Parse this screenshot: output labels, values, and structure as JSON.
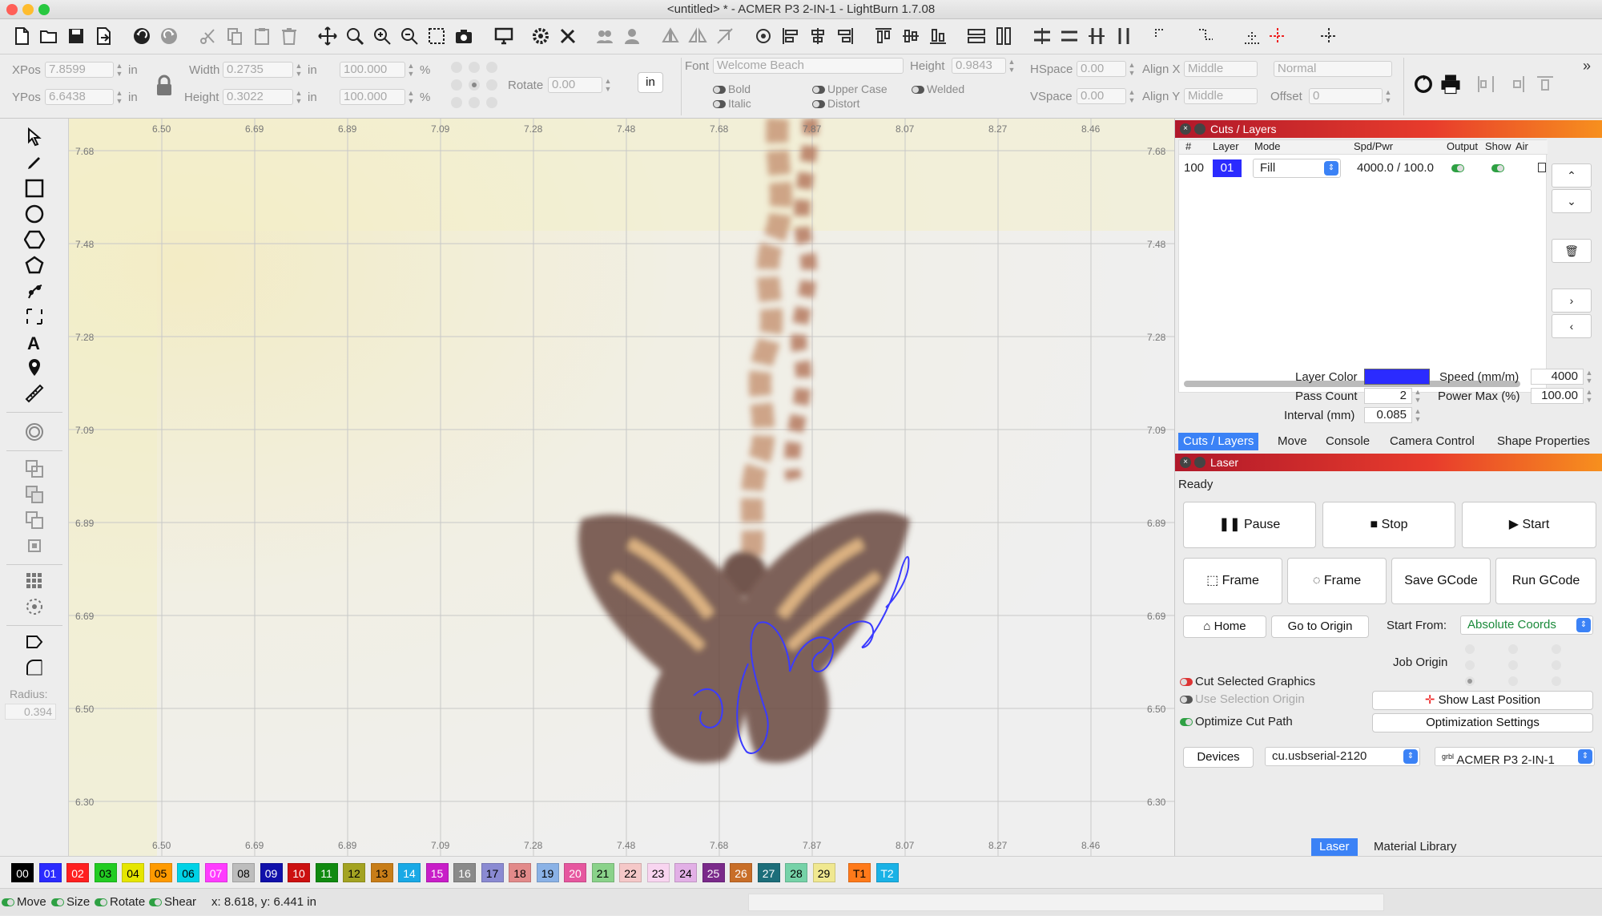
{
  "window": {
    "title": "<untitled> * - ACMER P3 2-IN-1 - LightBurn 1.7.08"
  },
  "props": {
    "xpos_label": "XPos",
    "xpos_value": "7.8599",
    "xpos_unit": "in",
    "ypos_label": "YPos",
    "ypos_value": "6.6438",
    "ypos_unit": "in",
    "width_label": "Width",
    "width_value": "0.2735",
    "width_unit": "in",
    "height_label": "Height",
    "height_value": "0.3022",
    "height_unit": "in",
    "scale_w": "100.000",
    "scale_h": "100.000",
    "pct": "%",
    "rotate_label": "Rotate",
    "rotate_value": "0.00",
    "units_button": "in",
    "font_label": "Font",
    "font_value": "Welcome Beach",
    "fheight_label": "Height",
    "fheight_value": "0.9843",
    "hspace_label": "HSpace",
    "hspace_value": "0.00",
    "vspace_label": "VSpace",
    "vspace_value": "0.00",
    "alignx_label": "Align X",
    "alignx_value": "Middle",
    "aligny_label": "Align Y",
    "aligny_value": "Middle",
    "normal_value": "Normal",
    "offset_label": "Offset",
    "offset_value": "0",
    "bold": "Bold",
    "italic": "Italic",
    "upper_case": "Upper Case",
    "distort": "Distort",
    "welded": "Welded"
  },
  "ruler": {
    "x": [
      "6.50",
      "6.69",
      "6.89",
      "7.09",
      "7.28",
      "7.48",
      "7.68",
      "7.87",
      "8.07",
      "8.27",
      "8.46"
    ],
    "y": [
      "7.68",
      "7.48",
      "7.28",
      "7.09",
      "6.89",
      "6.69",
      "6.50",
      "6.30"
    ]
  },
  "canvas": {
    "text": "Mom"
  },
  "left": {
    "radius_label": "Radius:",
    "radius_value": "0.394"
  },
  "cuts": {
    "title": "Cuts / Layers",
    "headers": [
      "#",
      "Layer",
      "Mode",
      "Spd/Pwr",
      "Output",
      "Show",
      "Air"
    ],
    "row": {
      "num": "100",
      "layer": "01",
      "mode": "Fill",
      "spd": "4000.0 / 100.0"
    },
    "layer_color_label": "Layer Color",
    "layer_color": "#2b2bff",
    "speed_label": "Speed (mm/m)",
    "speed_value": "4000",
    "pass_label": "Pass Count",
    "pass_value": "2",
    "power_label": "Power Max (%)",
    "power_value": "100.00",
    "interval_label": "Interval (mm)",
    "interval_value": "0.085"
  },
  "tabs": [
    "Cuts / Layers",
    "Move",
    "Console",
    "Camera Control",
    "Shape Properties"
  ],
  "laser": {
    "title": "Laser",
    "status": "Ready",
    "pause": "Pause",
    "stop": "Stop",
    "start": "Start",
    "frame1": "Frame",
    "frame2": "Frame",
    "save_gcode": "Save GCode",
    "run_gcode": "Run GCode",
    "home": "Home",
    "go_origin": "Go to Origin",
    "start_from_label": "Start From:",
    "start_from_value": "Absolute Coords",
    "job_origin": "Job Origin",
    "cut_selected": "Cut Selected Graphics",
    "use_selection": "Use Selection Origin",
    "optimize_path": "Optimize Cut Path",
    "show_last": "Show Last Position",
    "opt_settings": "Optimization Settings",
    "devices": "Devices",
    "port": "cu.usbserial-2120",
    "device_prefix": "grbl",
    "device": "ACMER P3 2-IN-1"
  },
  "bottom_tabs": [
    "Laser",
    "Material Library"
  ],
  "palette": [
    {
      "l": "00",
      "c": "#000000",
      "t": "#ffffff"
    },
    {
      "l": "01",
      "c": "#2b2bff",
      "t": "#ffffff"
    },
    {
      "l": "02",
      "c": "#ff2020",
      "t": "#ffffff"
    },
    {
      "l": "03",
      "c": "#22cc22",
      "t": "#000000"
    },
    {
      "l": "04",
      "c": "#e6e600",
      "t": "#000000"
    },
    {
      "l": "05",
      "c": "#ff9a00",
      "t": "#000000"
    },
    {
      "l": "06",
      "c": "#00d2e6",
      "t": "#000000"
    },
    {
      "l": "07",
      "c": "#ff3cff",
      "t": "#ffffff"
    },
    {
      "l": "08",
      "c": "#bdbdbd",
      "t": "#000000"
    },
    {
      "l": "09",
      "c": "#1010aa",
      "t": "#ffffff"
    },
    {
      "l": "10",
      "c": "#cc1010",
      "t": "#ffffff"
    },
    {
      "l": "11",
      "c": "#108a10",
      "t": "#ffffff"
    },
    {
      "l": "12",
      "c": "#a3a322",
      "t": "#000000"
    },
    {
      "l": "13",
      "c": "#c87d18",
      "t": "#000000"
    },
    {
      "l": "14",
      "c": "#19a9e6",
      "t": "#ffffff"
    },
    {
      "l": "15",
      "c": "#c81ec8",
      "t": "#ffffff"
    },
    {
      "l": "16",
      "c": "#8a8a8a",
      "t": "#ffffff"
    },
    {
      "l": "17",
      "c": "#8a8ad2",
      "t": "#000000"
    },
    {
      "l": "18",
      "c": "#e28a8a",
      "t": "#000000"
    },
    {
      "l": "19",
      "c": "#8ab2e6",
      "t": "#000000"
    },
    {
      "l": "20",
      "c": "#e6579f",
      "t": "#ffffff"
    },
    {
      "l": "21",
      "c": "#8ad28a",
      "t": "#000000"
    },
    {
      "l": "22",
      "c": "#f5c8c8",
      "t": "#000000"
    },
    {
      "l": "23",
      "c": "#f8d5f0",
      "t": "#000000"
    },
    {
      "l": "24",
      "c": "#e2b0e6",
      "t": "#000000"
    },
    {
      "l": "25",
      "c": "#7a2a8a",
      "t": "#ffffff"
    },
    {
      "l": "26",
      "c": "#c86e28",
      "t": "#ffffff"
    },
    {
      "l": "27",
      "c": "#1d6e7a",
      "t": "#ffffff"
    },
    {
      "l": "28",
      "c": "#76d2a8",
      "t": "#000000"
    },
    {
      "l": "29",
      "c": "#f0e890",
      "t": "#000000"
    },
    {
      "l": "T1",
      "c": "#ff7a1a",
      "t": "#000000"
    },
    {
      "l": "T2",
      "c": "#1ab2e6",
      "t": "#ffffff"
    }
  ],
  "status": {
    "move": "Move",
    "size": "Size",
    "rotate": "Rotate",
    "shear": "Shear",
    "coords": "x: 8.618, y: 6.441 in"
  }
}
